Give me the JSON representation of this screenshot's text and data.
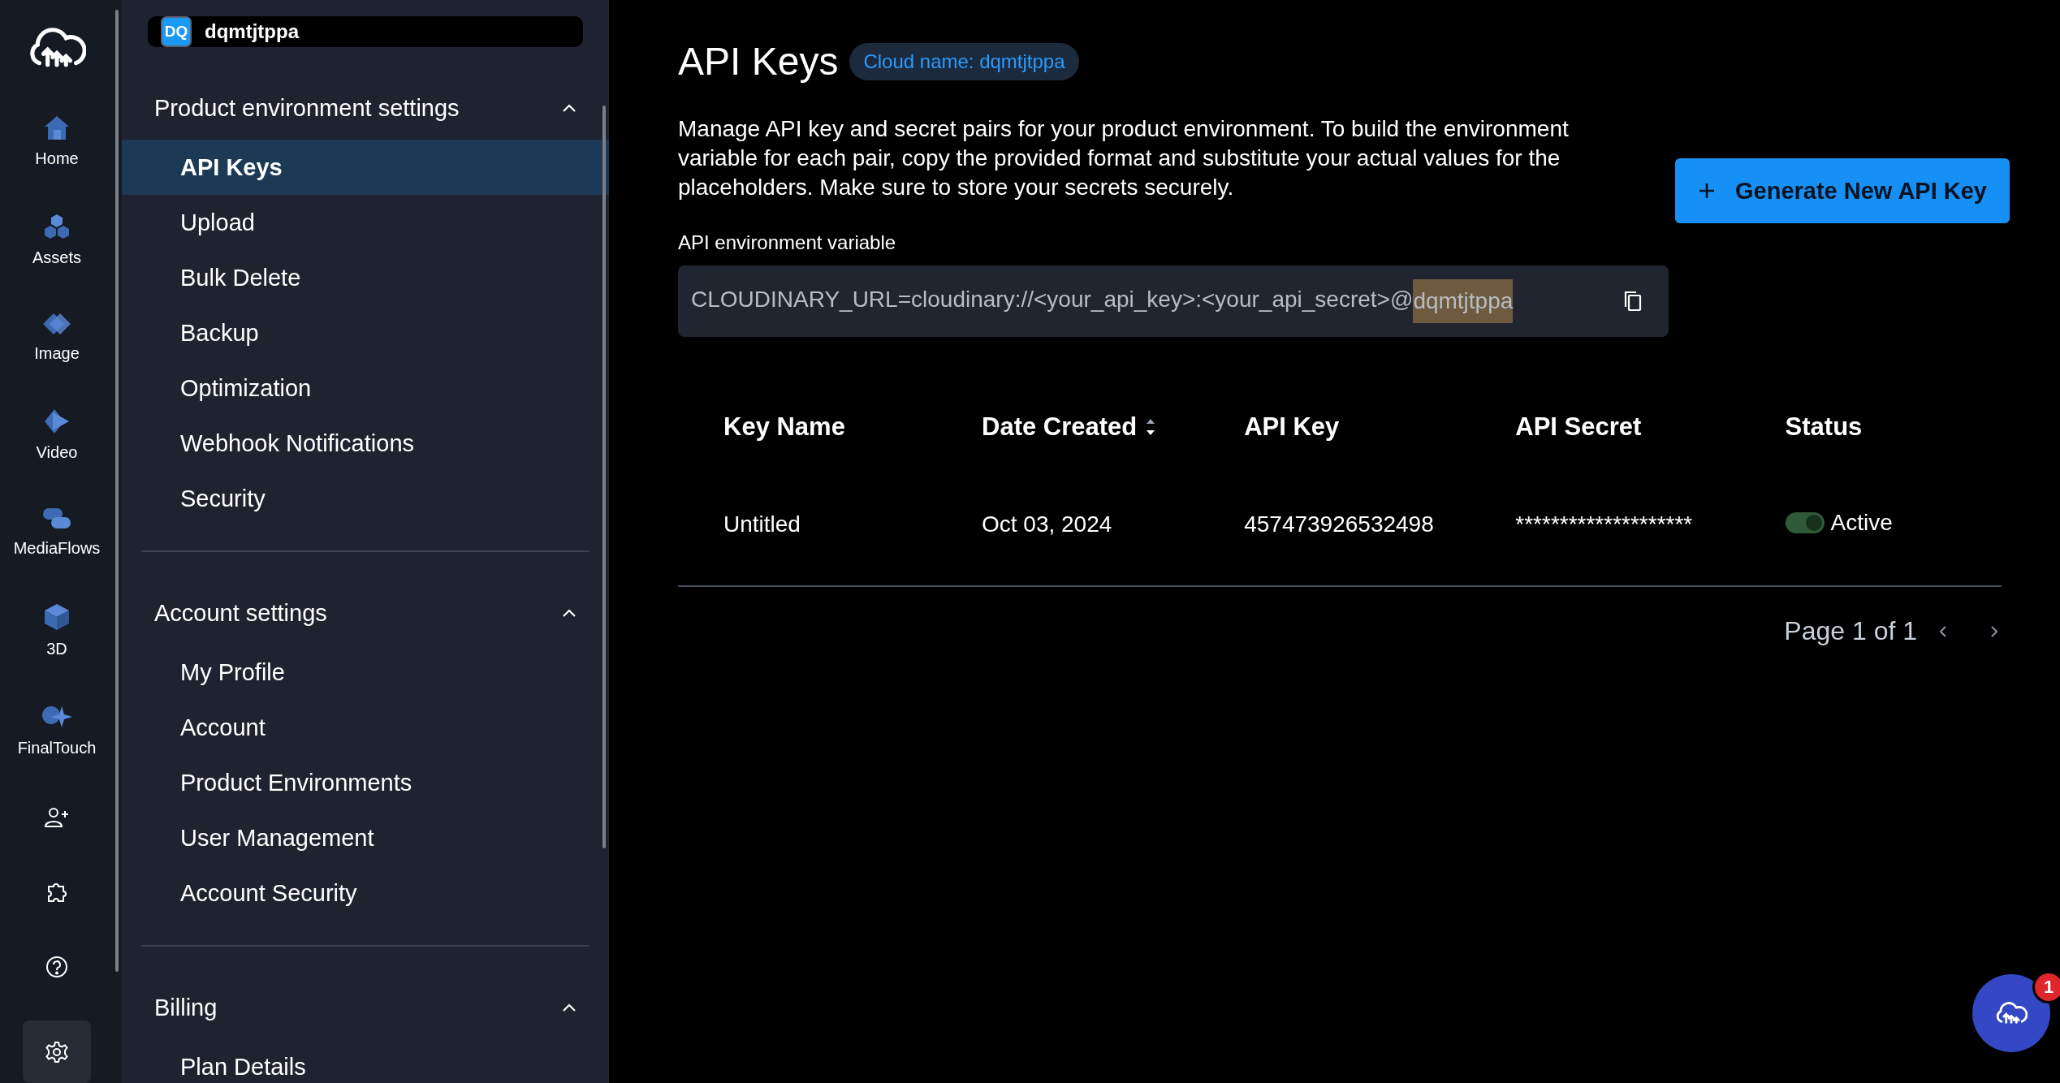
{
  "rail": {
    "items": [
      {
        "kind": "home",
        "label": "Home",
        "selected": false
      },
      {
        "kind": "assets",
        "label": "Assets",
        "selected": false
      },
      {
        "kind": "image",
        "label": "Image",
        "selected": false
      },
      {
        "kind": "video",
        "label": "Video",
        "selected": false
      },
      {
        "kind": "mediaflows",
        "label": "MediaFlows",
        "selected": false
      },
      {
        "kind": "cube",
        "label": "3D",
        "selected": false
      },
      {
        "kind": "finaltouch",
        "label": "FinalTouch",
        "selected": false
      },
      {
        "kind": "add-user",
        "selected": false
      },
      {
        "kind": "puzzle",
        "selected": false
      },
      {
        "kind": "help",
        "selected": false
      },
      {
        "kind": "settings",
        "selected": true
      }
    ]
  },
  "account": {
    "initials": "DQ",
    "name": "dqmtjtppa"
  },
  "sidebar": {
    "sections": [
      {
        "title": "Product environment settings",
        "expanded": true,
        "items": [
          {
            "label": "API Keys",
            "selected": true
          },
          {
            "label": "Upload",
            "selected": false
          },
          {
            "label": "Bulk Delete",
            "selected": false
          },
          {
            "label": "Backup",
            "selected": false
          },
          {
            "label": "Optimization",
            "selected": false
          },
          {
            "label": "Webhook Notifications",
            "selected": false
          },
          {
            "label": "Security",
            "selected": false
          }
        ]
      },
      {
        "title": "Account settings",
        "expanded": true,
        "items": [
          {
            "label": "My Profile",
            "selected": false
          },
          {
            "label": "Account",
            "selected": false
          },
          {
            "label": "Product Environments",
            "selected": false
          },
          {
            "label": "User Management",
            "selected": false
          },
          {
            "label": "Account Security",
            "selected": false
          }
        ]
      },
      {
        "title": "Billing",
        "expanded": true,
        "items": [
          {
            "label": "Plan Details",
            "selected": false
          }
        ]
      }
    ]
  },
  "main": {
    "title": "API Keys",
    "cloud_badge": "Cloud name: dqmtjtppa",
    "description": "Manage API key and secret pairs for your product environment. To build the environment variable for each pair, copy the provided format and substitute your actual values for the placeholders. Make sure to store your secrets securely.",
    "generate_button": "Generate New API Key",
    "env_label": "API environment variable",
    "env_value": {
      "text": "CLOUDINARY_URL=cloudinary://<your_api_key>:<your_api_secret>@",
      "highlighted": "dqmtjtppa"
    },
    "table": {
      "columns": [
        {
          "label": "Key Name",
          "sortable": false
        },
        {
          "label": "Date Created",
          "sortable": true
        },
        {
          "label": "API Key",
          "sortable": false
        },
        {
          "label": "API Secret",
          "sortable": false
        },
        {
          "label": "Status",
          "sortable": false
        }
      ],
      "rows": [
        {
          "key_name": "Untitled",
          "date_created": "Oct 03, 2024",
          "api_key": "457473926532498",
          "api_secret": "********************",
          "active": true,
          "status": "Active"
        }
      ]
    },
    "pagination": "Page 1 of 1"
  },
  "chat": {
    "badge": "1"
  }
}
